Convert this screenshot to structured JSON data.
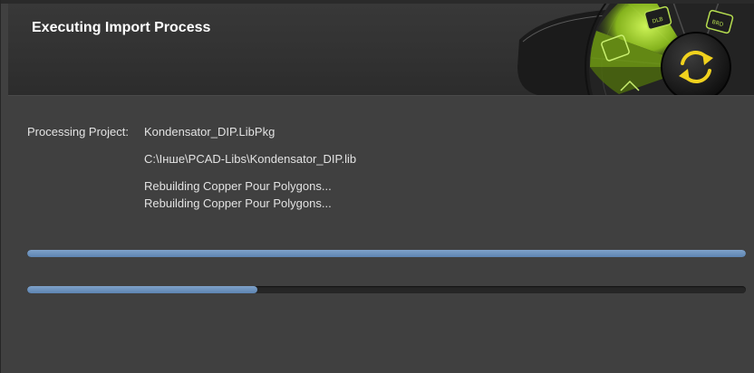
{
  "dialog": {
    "title": "Executing Import Process"
  },
  "details": {
    "project_label": "Processing Project:",
    "project_value": "Kondensator_DIP.LibPkg",
    "file_path": "C:\\Інше\\PCAD-Libs\\Kondensator_DIP.lib",
    "status_lines": [
      "Rebuilding Copper Pour Polygons...",
      "Rebuilding Copper Pour Polygons..."
    ]
  },
  "progress": {
    "overall_percent": 100,
    "current_percent": 32
  },
  "header_graphic": {
    "icon": "sync-icon",
    "accent_color": "#a6d82a",
    "icon_color": "#f1d21e"
  }
}
